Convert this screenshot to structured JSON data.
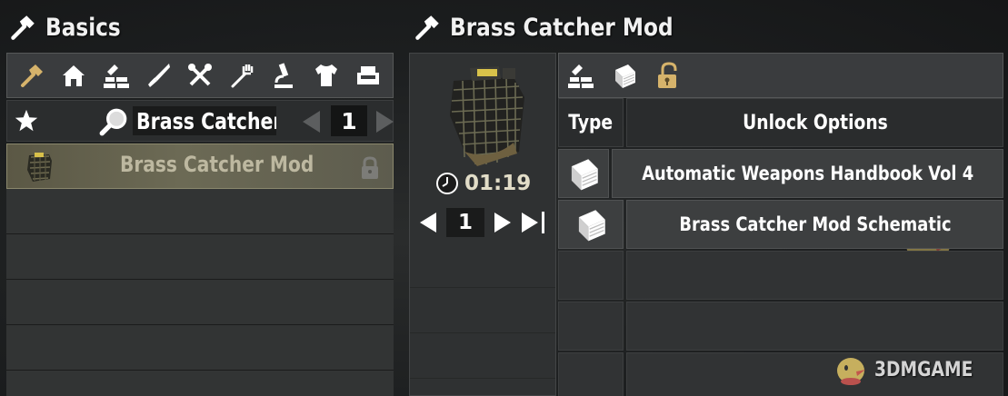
{
  "left_panel": {
    "title": "Basics",
    "title_icon": "hammer-icon",
    "categories": [
      {
        "name": "basics",
        "icon": "hammer-icon",
        "active": true
      },
      {
        "name": "building",
        "icon": "house-icon",
        "active": false
      },
      {
        "name": "resources",
        "icon": "bricks-icon",
        "active": false
      },
      {
        "name": "weapons",
        "icon": "knife-icon",
        "active": false
      },
      {
        "name": "tools",
        "icon": "tools-icon",
        "active": false
      },
      {
        "name": "food",
        "icon": "fork-icon",
        "active": false
      },
      {
        "name": "science",
        "icon": "microscope-icon",
        "active": false
      },
      {
        "name": "clothing",
        "icon": "shirt-icon",
        "active": false
      },
      {
        "name": "decor",
        "icon": "armchair-icon",
        "active": false
      }
    ],
    "search": {
      "query": "Brass Catcher",
      "page": "1"
    },
    "recipes": [
      {
        "name": "Brass Catcher Mod",
        "locked": true,
        "selected": true
      }
    ]
  },
  "craft_panel": {
    "title": "Brass Catcher Mod",
    "craft_time": "01:19",
    "quantity": "1"
  },
  "info_panel": {
    "tabs": [
      {
        "name": "ingredients",
        "icon": "bricks-icon"
      },
      {
        "name": "description",
        "icon": "book-icon"
      },
      {
        "name": "unlock",
        "icon": "unlock-icon",
        "active": true
      }
    ],
    "table": {
      "header_type": "Type",
      "header_options": "Unlock Options",
      "rows": [
        {
          "type_icon": "book-icon",
          "option": "Automatic Weapons Handbook Vol 4"
        },
        {
          "type_icon": "book-icon",
          "option": "Brass Catcher Mod Schematic"
        }
      ]
    }
  },
  "watermark": {
    "text": "3DMGAME"
  },
  "colors": {
    "accent": "#d6b36b",
    "panel": "#3a3c3e",
    "selected_row": "#6c6a55"
  }
}
